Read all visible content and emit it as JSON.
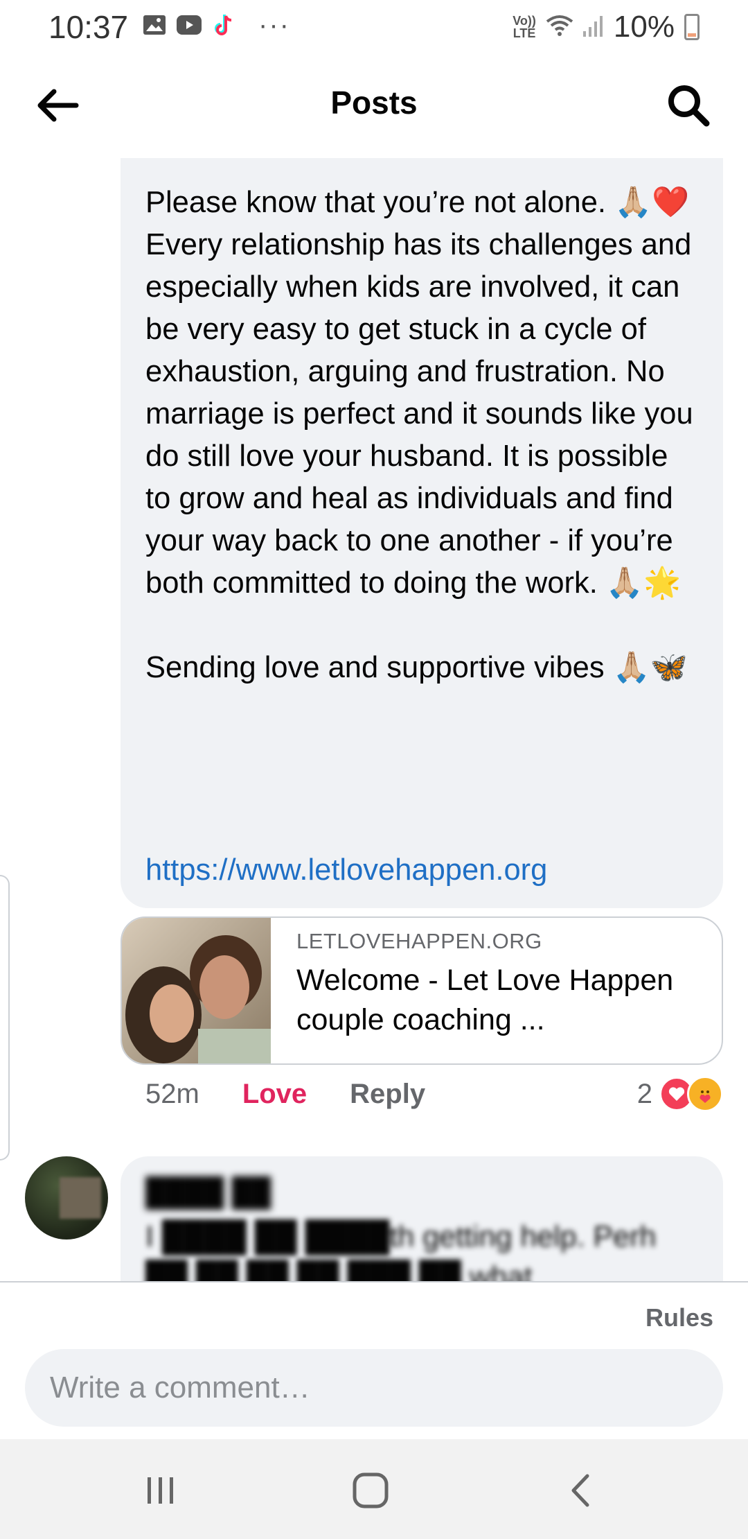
{
  "status_bar": {
    "time": "10:37",
    "more": "···",
    "volte": "Vo))\nLTE",
    "battery": "10%",
    "icons": [
      "image-icon",
      "youtube-icon",
      "tiktok-icon",
      "wifi-icon",
      "signal-icon",
      "battery-icon"
    ]
  },
  "header": {
    "title": "Posts",
    "back_icon": "back-arrow-icon",
    "search_icon": "search-icon"
  },
  "comment": {
    "text": "Please know that you’re not alone. 🙏🏼❤️ Every relationship has its challenges and especially when kids are involved, it can be very easy to get stuck in a cycle of exhaustion, arguing and frustration. No marriage is perfect and it sounds like you do still love your husband. It is possible to grow and heal as individuals and find your way back to one another - if you’re both committed to doing the work. 🙏🏼🌟\n\nSending love and supportive vibes 🙏🏼🦋",
    "link": "https://www.letlovehappen.org",
    "preview": {
      "domain": "LETLOVEHAPPEN.ORG",
      "title": "Welcome - Let Love Happen couple coaching ..."
    },
    "time_ago": "52m",
    "love_label": "Love",
    "reply_label": "Reply",
    "reaction_count": "2",
    "reactions": [
      "love-reaction-icon",
      "care-reaction-icon"
    ]
  },
  "next_comment": {
    "name": "████ ██",
    "text": "I ████ ██ ████th getting help. Perh ██ ██ ██ ██ ███ ██ what"
  },
  "composer": {
    "rules_label": "Rules",
    "placeholder": "Write a comment…"
  },
  "nav": {
    "recents_icon": "recents-icon",
    "home_icon": "home-icon",
    "back_icon": "nav-back-icon"
  },
  "colors": {
    "accent_link": "#1f6fc5",
    "love": "#e0245e",
    "bubble_bg": "#f0f2f5"
  }
}
